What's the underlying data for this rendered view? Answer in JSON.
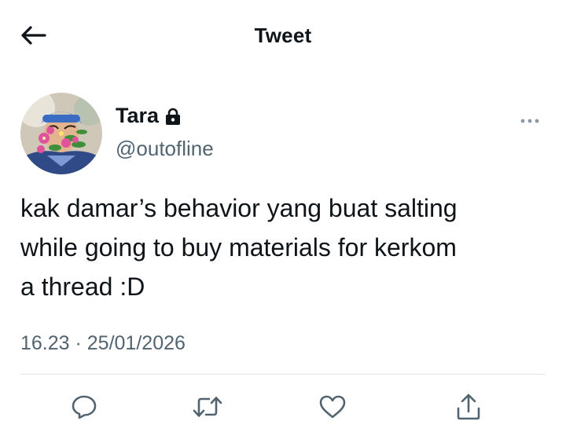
{
  "header": {
    "title": "Tweet",
    "back_icon": "arrow-left-icon"
  },
  "author": {
    "display_name": "Tara",
    "handle": "@outofline",
    "protected_icon": "lock-icon",
    "more_icon": "more-horizontal-icon"
  },
  "tweet": {
    "text_lines": [
      "kak damar’s behavior yang buat salting",
      "while going to buy materials for kerkom",
      "a thread :D"
    ],
    "timestamp": "16.23 · 25/01/2026"
  },
  "actions": {
    "icons": [
      "reply-icon",
      "retweet-icon",
      "like-icon",
      "share-icon"
    ]
  },
  "colors": {
    "text_primary": "#0f1419",
    "text_secondary": "#536471",
    "icon": "#536471",
    "divider": "#e1e6ea"
  }
}
